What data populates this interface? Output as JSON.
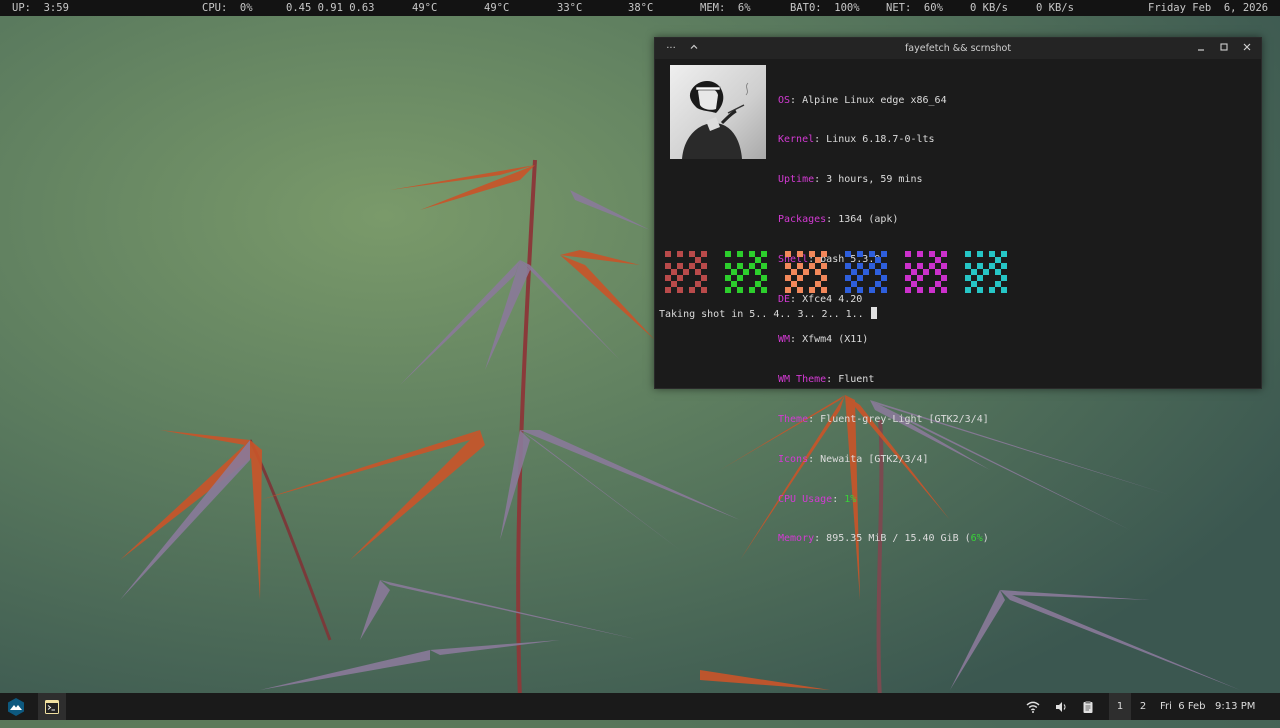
{
  "topbar": {
    "up": "UP:  3:59",
    "cpu": "CPU:  0%",
    "load": "0.45 0.91 0.63",
    "temp1": "49°C",
    "temp2": "49°C",
    "temp3": "33°C",
    "temp4": "38°C",
    "mem": "MEM:  6%",
    "bat": "BAT0:  100%",
    "net": "NET:  60%",
    "down": "0 KB/s",
    "upload": "0 KB/s",
    "date": "Friday Feb  6, 2026"
  },
  "terminal": {
    "title": "fayefetch && scrnshot",
    "menu_glyph": "···",
    "up_glyph": "^",
    "info": [
      {
        "key": "OS",
        "value": "Alpine Linux edge x86_64"
      },
      {
        "key": "Kernel",
        "value": "Linux 6.18.7-0-lts"
      },
      {
        "key": "Uptime",
        "value": "3 hours, 59 mins"
      },
      {
        "key": "Packages",
        "value": "1364 (apk)"
      },
      {
        "key": "Shell",
        "value": "bash 5.3.9"
      },
      {
        "key": "DE",
        "value": "Xfce4 4.20"
      },
      {
        "key": "WM",
        "value": "Xfwm4 (X11)"
      },
      {
        "key": "WM Theme",
        "value": "Fluent"
      },
      {
        "key": "Theme",
        "value": "Fluent-grey-Light [GTK2/3/4]"
      },
      {
        "key": "Icons",
        "value": "Newaita [GTK2/3/4]"
      },
      {
        "key": "CPU Usage",
        "value": "1%"
      },
      {
        "key": "Memory",
        "value": "895.35 MiB / 15.40 GiB (",
        "value_highlight": "6%",
        "value_tail": ")"
      }
    ],
    "block_colors": [
      "#b94a4a",
      "#2ccf2c",
      "#f2885a",
      "#2e5fdc",
      "#cc30cc",
      "#26c6c6"
    ],
    "prompt": "Taking shot in 5.. 4.. 3.. 2.. 1.. "
  },
  "panel": {
    "workspace1": "1",
    "workspace2": "2",
    "clock": "Fri  6 Feb   9:13 PM"
  },
  "icons": {
    "app_menu": "alpine-logo-icon",
    "terminal": "terminal-icon",
    "wifi": "wifi-icon",
    "volume": "volume-icon",
    "clipboard": "clipboard-icon"
  }
}
